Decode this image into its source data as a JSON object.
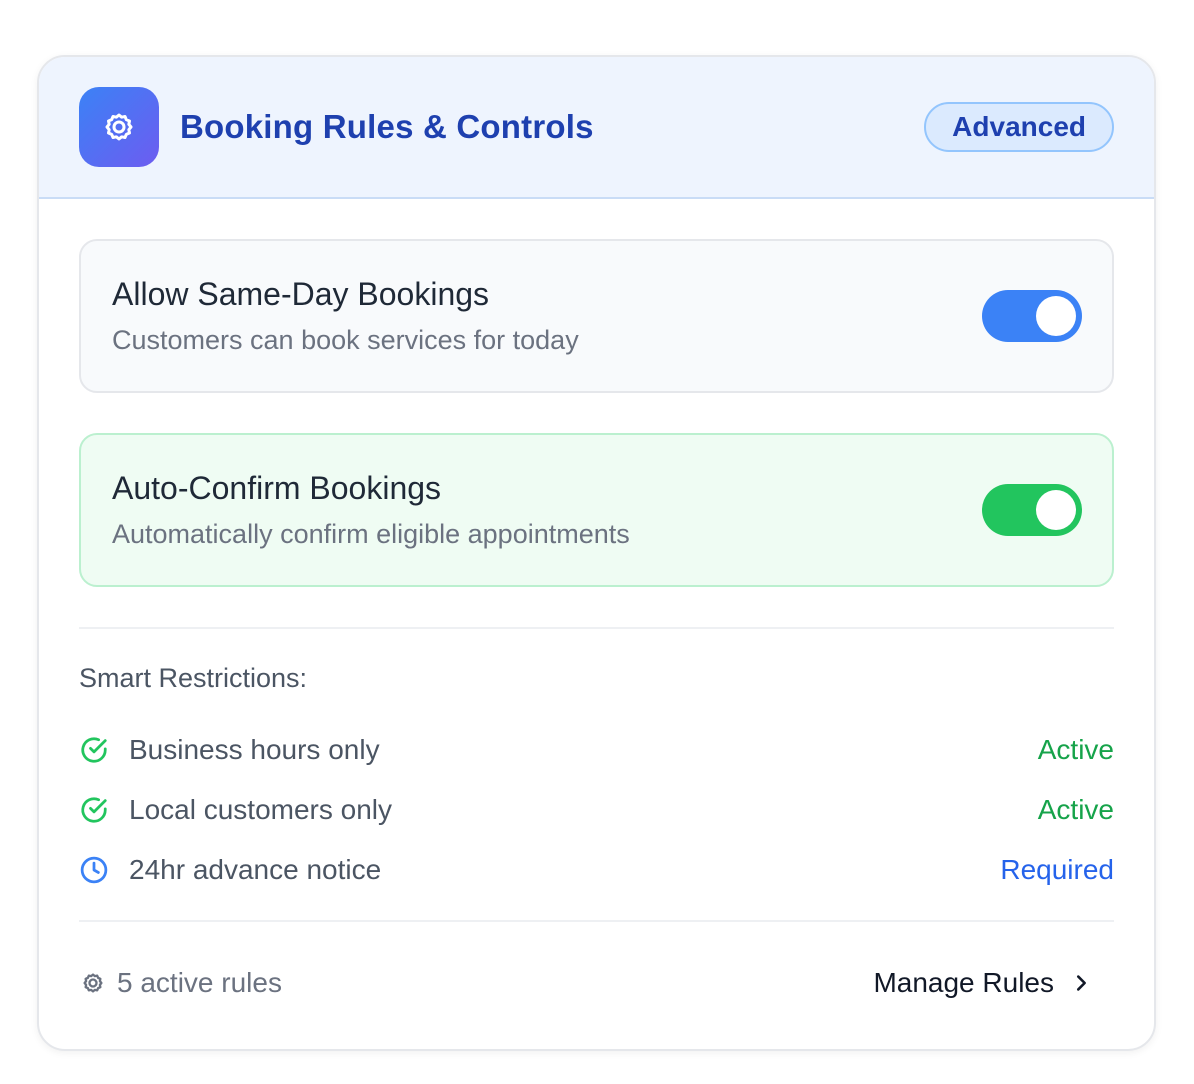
{
  "header": {
    "icon": "gear-icon",
    "title": "Booking Rules & Controls",
    "badge": "Advanced"
  },
  "toggles": [
    {
      "title": "Allow Same-Day Bookings",
      "description": "Customers can book services for today",
      "enabled": true,
      "color": "#3b82f6"
    },
    {
      "title": "Auto-Confirm Bookings",
      "description": "Automatically confirm eligible appointments",
      "enabled": true,
      "color": "#22c55e"
    }
  ],
  "restrictions": {
    "title": "Smart Restrictions:",
    "items": [
      {
        "icon": "check-circle-icon",
        "label": "Business hours only",
        "status": "Active",
        "status_color": "#16a34a"
      },
      {
        "icon": "check-circle-icon",
        "label": "Local customers only",
        "status": "Active",
        "status_color": "#16a34a"
      },
      {
        "icon": "clock-icon",
        "label": "24hr advance notice",
        "status": "Required",
        "status_color": "#2563eb"
      }
    ]
  },
  "footer": {
    "icon": "gear-icon",
    "summary": "5 active rules",
    "manage_label": "Manage Rules"
  }
}
